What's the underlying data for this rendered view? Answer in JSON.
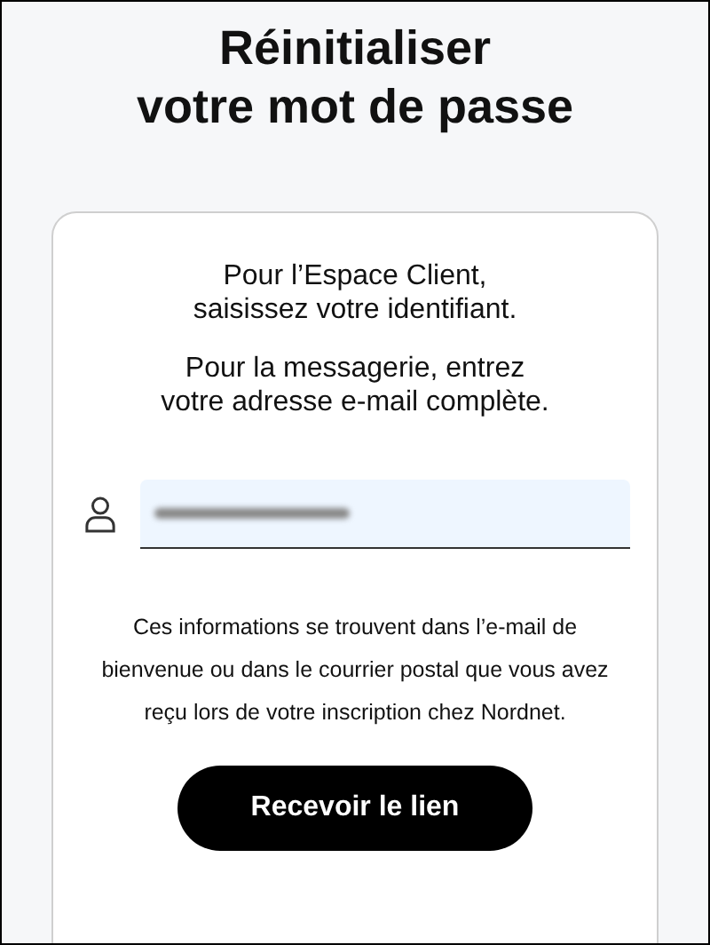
{
  "title": [
    "Réinitialiser",
    "votre mot de passe"
  ],
  "card": {
    "intro": [
      "Pour l’Espace Client,\nsaisissez votre identifiant.",
      "Pour la messagerie, entrez\nvotre adresse e-mail complète."
    ],
    "identifier_field": {
      "value_redacted": true
    },
    "help": "Ces informations se trouvent dans l’e-mail de bienvenue ou dans le courrier postal que vous avez reçu lors de votre inscription chez Nordnet.",
    "button": "Recevoir le lien"
  }
}
